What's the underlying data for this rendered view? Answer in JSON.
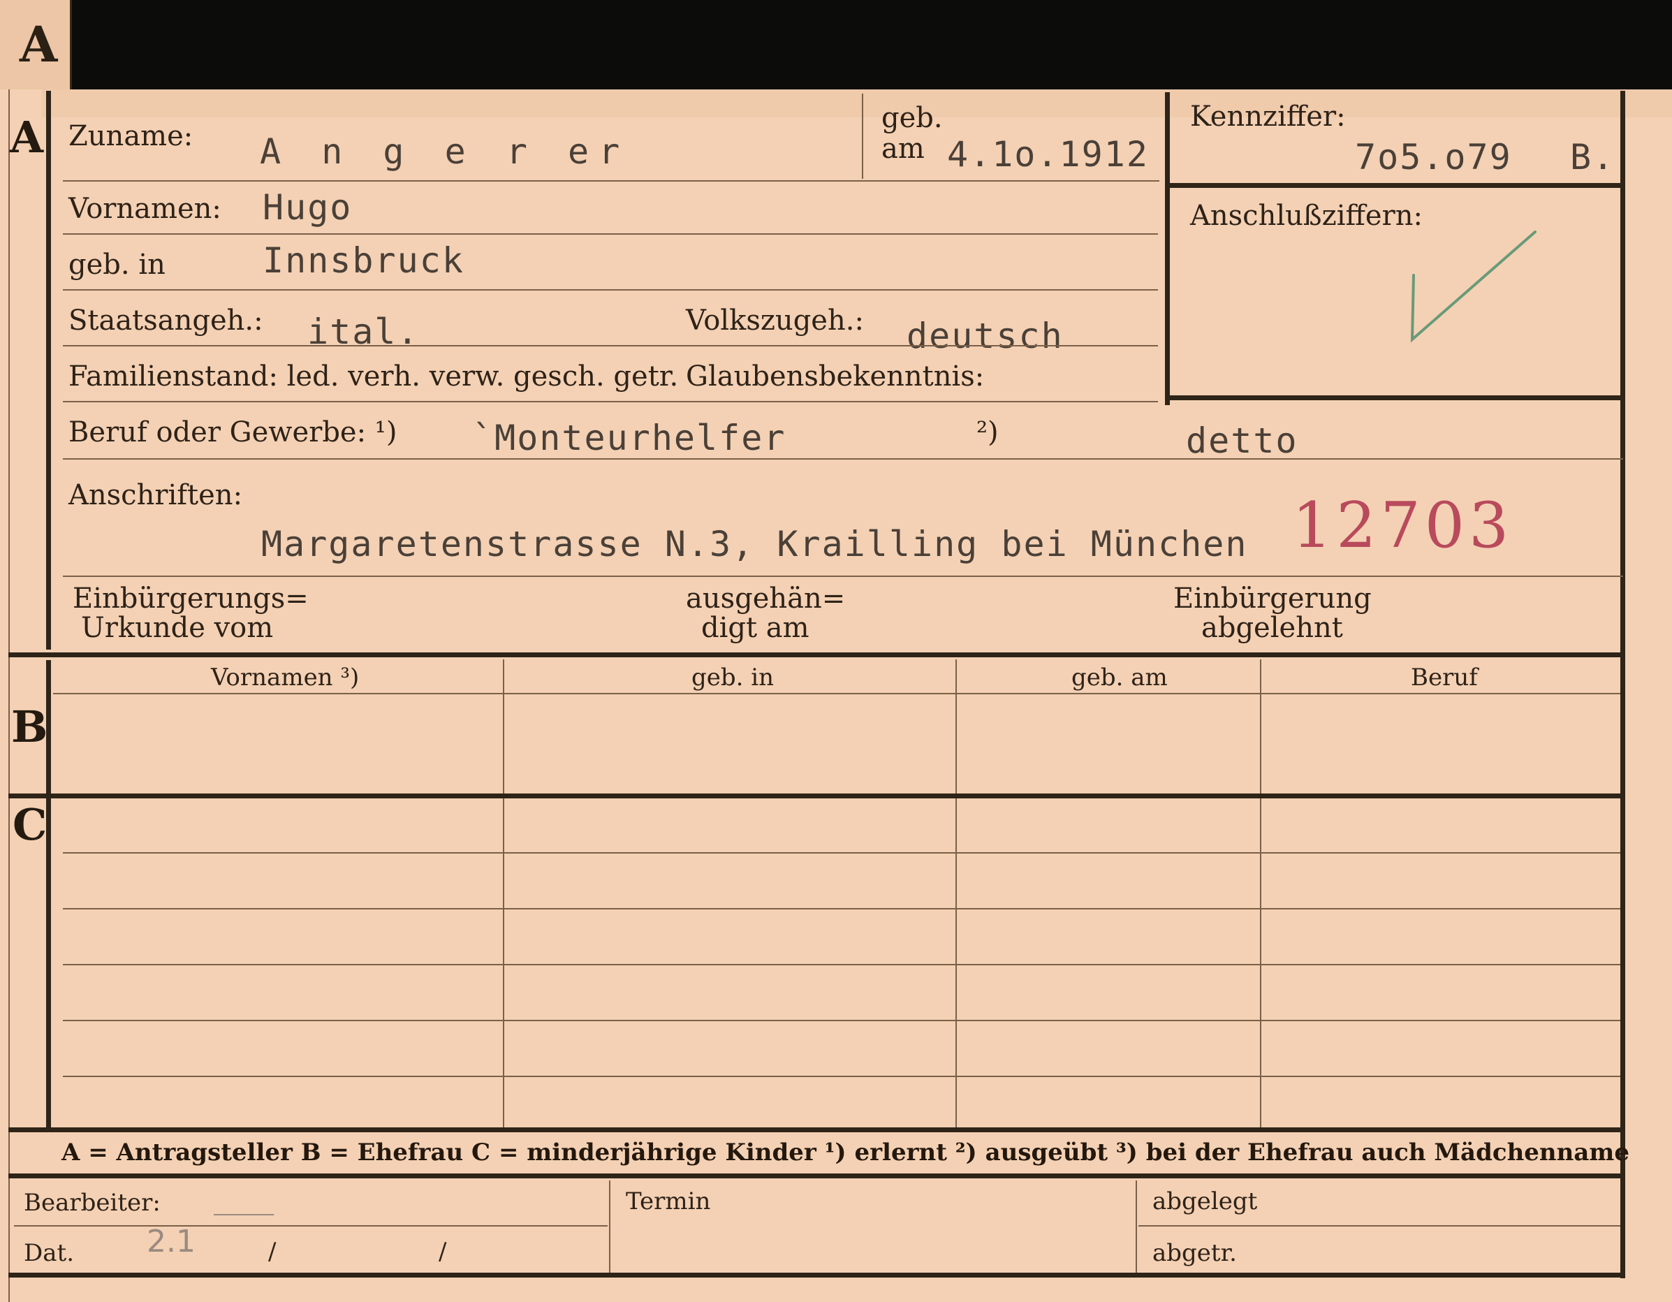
{
  "sections": {
    "a": "A",
    "b": "B",
    "c": "C"
  },
  "labels": {
    "zuname": "Zuname:",
    "geb_am_1": "geb.",
    "geb_am_2": "am",
    "kennziffer": "Kennziffer:",
    "anschlussziffern": "Anschlußziffern:",
    "vornamen": "Vornamen:",
    "geb_in": "geb. in",
    "staatsangeh": "Staatsangeh.:",
    "volkszugeh": "Volkszugeh.:",
    "familienstand": "Familienstand: led. verh. verw. gesch. getr.",
    "glaubensbekenntnis": "Glaubensbekenntnis:",
    "beruf": "Beruf oder Gewerbe: ¹)",
    "beruf_2": "²)",
    "anschriften": "Anschriften:",
    "einbuergerung_1": "Einbürgerungs=",
    "einbuergerung_2": "Urkunde vom",
    "ausgehaen_1": "ausgehän=",
    "ausgehaen_2": "digt am",
    "einb_abgelehnt_1": "Einbürgerung",
    "einb_abgelehnt_2": "abgelehnt"
  },
  "values": {
    "zuname": "A n g e r er",
    "geb_am": "4.1o.1912",
    "kennziffer": "7o5.o79",
    "kennziffer_suffix": "B.",
    "vornamen": "Hugo",
    "geb_in": "Innsbruck",
    "staatsangeh": "ital.",
    "volkszugeh": "deutsch",
    "beruf_1": "`Monteurhelfer",
    "beruf_2": "detto",
    "anschrift": "Margaretenstrasse N.3, Krailling  bei München",
    "stamp_number": "12703"
  },
  "table": {
    "headers": [
      "Vornamen ³)",
      "geb. in",
      "geb. am",
      "Beruf"
    ]
  },
  "legend": "A = Antragsteller   B = Ehefrau   C = minderjährige Kinder   ¹) erlernt   ²) ausgeübt   ³) bei der Ehefrau auch Mädchenname",
  "footer": {
    "bearbeiter": "Bearbeiter:",
    "dat": "Dat.",
    "dat_pencil": "2.1",
    "slash1": "/",
    "slash2": "/",
    "termin": "Termin",
    "abgelegt": "abgelegt",
    "abgetr": "abgetr."
  },
  "colors": {
    "paper": "#f4d1b4",
    "ink": "#2e2218",
    "stamp": "#b84a5c",
    "check": "#6a9a7a"
  }
}
